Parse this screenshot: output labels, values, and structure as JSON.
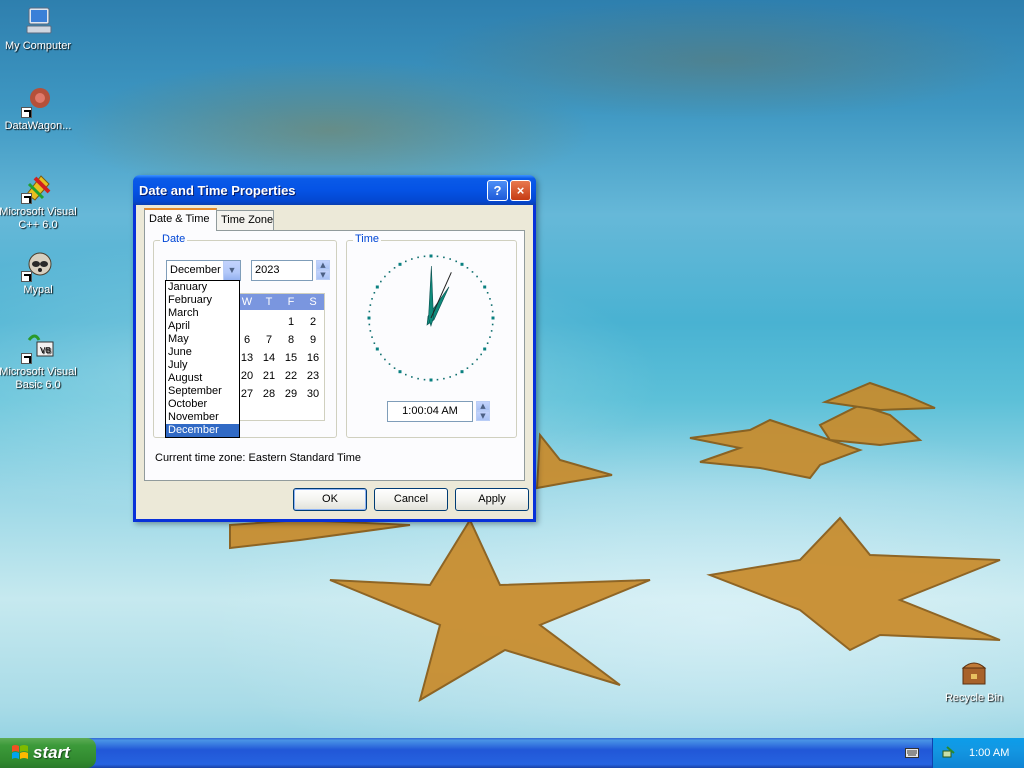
{
  "desktop": {
    "icons": [
      {
        "label": "My Computer"
      },
      {
        "label": "DataWagon..."
      },
      {
        "label": "Microsoft Visual C++ 6.0"
      },
      {
        "label": "Mypal"
      },
      {
        "label": "Microsoft Visual Basic 6.0"
      },
      {
        "label": "Recycle Bin"
      }
    ]
  },
  "dialog": {
    "title": "Date and Time Properties",
    "help_btn": "?",
    "close_btn": "×",
    "tabs": [
      "Date & Time",
      "Time Zone"
    ],
    "date_group_label": "Date",
    "time_group_label": "Time",
    "month_value": "December",
    "year_value": "2023",
    "months": [
      "January",
      "February",
      "March",
      "April",
      "May",
      "June",
      "July",
      "August",
      "September",
      "October",
      "November",
      "December"
    ],
    "selected_month": "December",
    "calendar_visible_headers": [
      "W",
      "T",
      "F",
      "S"
    ],
    "calendar_rows": [
      [
        "",
        "",
        "1",
        "2"
      ],
      [
        "6",
        "7",
        "8",
        "9"
      ],
      [
        "13",
        "14",
        "15",
        "16"
      ],
      [
        "20",
        "21",
        "22",
        "23"
      ],
      [
        "27",
        "28",
        "29",
        "30"
      ]
    ],
    "time_value": "1:00:04 AM",
    "clock": {
      "hour": 1,
      "minute": 0,
      "second": 4
    },
    "timezone_text": "Current time zone:  Eastern Standard Time",
    "buttons": {
      "ok": "OK",
      "cancel": "Cancel",
      "apply": "Apply"
    }
  },
  "taskbar": {
    "start_label": "start",
    "clock": "1:00 AM"
  },
  "colors": {
    "title_bar": "#0553e5",
    "selection": "#316ac5",
    "group_label": "#0046d5",
    "start_green": "#3c9a3a"
  }
}
